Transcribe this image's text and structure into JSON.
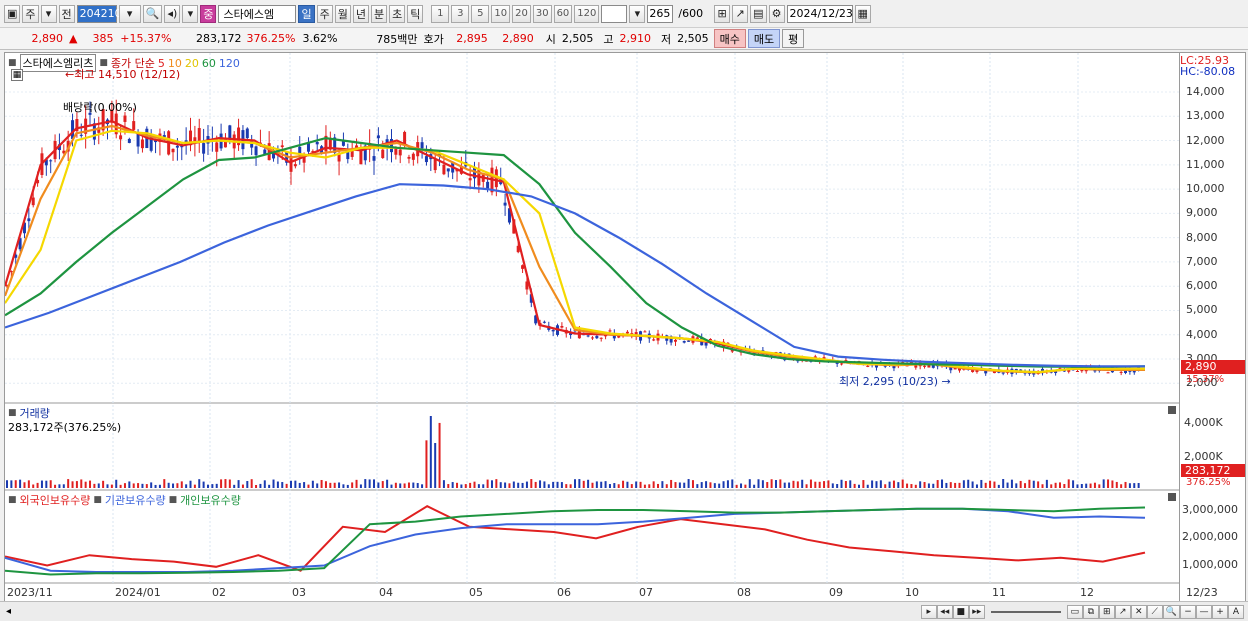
{
  "toolbar": {
    "market_label": "주",
    "prev_label": "전",
    "code": "204210",
    "badge_label": "중",
    "stock_name": "스타에스엠",
    "periods": [
      "일",
      "주",
      "월",
      "년",
      "분",
      "초",
      "틱"
    ],
    "active_period": "일",
    "counts": [
      "1",
      "3",
      "5",
      "10",
      "20",
      "30",
      "60",
      "120"
    ],
    "visible_count": "265",
    "max_count": "/600",
    "date": "2024/12/23"
  },
  "quote": {
    "price": "2,890",
    "change": "385",
    "change_pct": "+15.37%",
    "volume": "283,172",
    "volume_ratio": "376.25%",
    "turnover_rate": "3.62%",
    "amount": "785백만",
    "ask_label": "호가",
    "ask": "2,895",
    "bid": "2,890",
    "open_label": "시",
    "open": "2,505",
    "high_label": "고",
    "high": "2,910",
    "low_label": "저",
    "low": "2,505",
    "buy_label": "매수",
    "sell_label": "매도",
    "eval_label": "평"
  },
  "price_panel": {
    "stock_label": "스타에스엠리츠",
    "ma_title": "종가 단순",
    "ma_periods": [
      "5",
      "10",
      "20",
      "60",
      "120"
    ],
    "ma_colors": [
      "#e02020",
      "#f08c1e",
      "#f5d800",
      "#1e9440",
      "#3c64dc"
    ],
    "high_note": "←최고 14,510 (12/12)",
    "low_note": "최저 2,295 (10/23) →",
    "dividend_note": "배당락(0.00%)",
    "lc": "LC:25.93",
    "hc": "HC:-80.08",
    "y_ticks": [
      "14,000",
      "13,000",
      "12,000",
      "11,000",
      "10,000",
      "9,000",
      "8,000",
      "7,000",
      "6,000",
      "5,000",
      "4,000",
      "3,000",
      "2,000"
    ],
    "last_price_tag": "2,890",
    "last_change_tag": "15.37%"
  },
  "volume_panel": {
    "title": "거래량",
    "summary": "283,172주(376.25%)",
    "y_ticks": [
      "4,000K",
      "2,000K"
    ],
    "last_tag": "283,172",
    "last_ratio_tag": "376.25%"
  },
  "holding_panel": {
    "legend": [
      "외국인보유수량",
      "기관보유수량",
      "개인보유수량"
    ],
    "legend_colors": [
      "#e02020",
      "#3c64dc",
      "#1e9440"
    ],
    "y_ticks": [
      "3,000,000",
      "2,000,000",
      "1,000,000"
    ]
  },
  "x_axis": {
    "labels": [
      "2023/11",
      "2024/01",
      "02",
      "03",
      "04",
      "05",
      "06",
      "07",
      "08",
      "09",
      "10",
      "11",
      "12"
    ],
    "right_label": "12/23"
  },
  "chart_data": {
    "type": "line",
    "title": "",
    "ylim": [
      1600,
      14700
    ],
    "moving_averages": [
      {
        "name": "5",
        "values": [
          6000,
          11000,
          12500,
          12800,
          12100,
          11800,
          12100,
          12000,
          11100,
          11700,
          11600,
          12000,
          11300,
          10600,
          10300,
          4400,
          4050,
          4000,
          3950,
          3850,
          3650,
          3300,
          3100,
          2950,
          2800,
          2750,
          2800,
          2600,
          2500,
          2450,
          2600,
          2550,
          2550
        ]
      },
      {
        "name": "10",
        "values": [
          5600,
          9600,
          12300,
          12600,
          12200,
          11900,
          12000,
          11900,
          11300,
          11500,
          11700,
          11900,
          11500,
          10800,
          10400,
          6800,
          4200,
          4000,
          3950,
          3850,
          3700,
          3300,
          3100,
          2950,
          2800,
          2750,
          2800,
          2600,
          2500,
          2450,
          2600,
          2550,
          2550
        ]
      },
      {
        "name": "20",
        "values": [
          5300,
          7500,
          12000,
          12400,
          12300,
          11900,
          12000,
          11900,
          11500,
          11300,
          11700,
          11700,
          11600,
          11000,
          10400,
          9000,
          4300,
          4050,
          3950,
          3850,
          3700,
          3350,
          3150,
          2980,
          2800,
          2780,
          2800,
          2650,
          2520,
          2460,
          2600,
          2600,
          2600
        ]
      },
      {
        "name": "60",
        "values": [
          4800,
          5700,
          7000,
          8200,
          9300,
          10400,
          11200,
          11300,
          11700,
          12100,
          11900,
          11700,
          11600,
          11500,
          11400,
          10200,
          8200,
          6800,
          5300,
          4300,
          3550,
          3200,
          3000,
          2900,
          2860,
          2820,
          2780,
          2760,
          2720,
          2690,
          2680,
          2680,
          2700
        ]
      },
      {
        "name": "120",
        "values": [
          4300,
          4900,
          5600,
          6300,
          7000,
          7800,
          8500,
          9100,
          9700,
          10200,
          10150,
          10000,
          9700,
          9000,
          8000,
          6900,
          5700,
          4600,
          3500,
          3100,
          2970,
          2880,
          2820,
          2760,
          2720,
          2700,
          2700
        ]
      }
    ],
    "volume_peak": "4,600K",
    "holdings": [
      {
        "name": "외국인보유수량",
        "values": [
          1250000,
          900000,
          1300000,
          1150000,
          1050000,
          850000,
          1300000,
          700000,
          2400000,
          2200000,
          3200000,
          2400000,
          2300000,
          2200000,
          1950000,
          2400000,
          2700000,
          2500000,
          2300000,
          1900000,
          1600000,
          1450000,
          1300000,
          1200000,
          1100000,
          1200000,
          1050000,
          1400000
        ]
      },
      {
        "name": "기관보유수량",
        "values": [
          1200000,
          700000,
          650000,
          650000,
          650000,
          700000,
          800000,
          900000,
          1650000,
          2100000,
          2350000,
          2500000,
          2500000,
          2500000,
          2600000,
          2750000,
          2900000,
          2950000,
          3000000,
          3050000,
          3100000,
          3100000,
          3000000,
          2750000,
          2800000,
          2750000
        ]
      },
      {
        "name": "개인보유수량",
        "values": [
          700000,
          550000,
          600000,
          600000,
          620000,
          650000,
          700000,
          800000,
          2500000,
          2600000,
          2800000,
          2900000,
          3000000,
          3050000,
          3050000,
          3000000,
          2950000,
          2950000,
          3000000,
          3050000,
          3100000,
          3100000,
          3050000,
          3000000,
          3100000,
          3150000
        ]
      }
    ]
  }
}
